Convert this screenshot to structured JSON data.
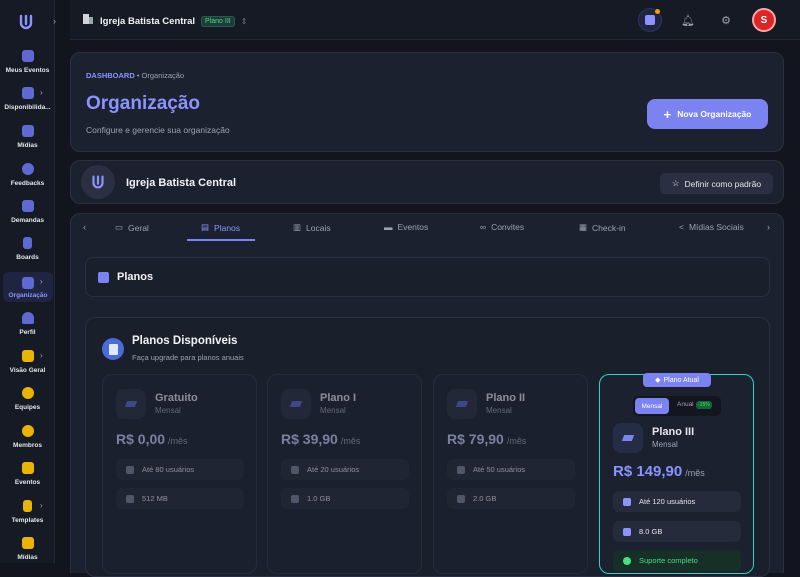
{
  "sidebar": {
    "items": [
      {
        "label": "Meus Eventos",
        "icon": "calendar-icon"
      },
      {
        "label": "Disponibilida...",
        "icon": "calendar-clock-icon",
        "has_arrow": true
      },
      {
        "label": "Mídias",
        "icon": "media-icon"
      },
      {
        "label": "Feedbacks",
        "icon": "chat-icon"
      },
      {
        "label": "Demandas",
        "icon": "inbox-icon"
      },
      {
        "label": "Boards",
        "icon": "board-icon"
      },
      {
        "label": "Organização",
        "icon": "building-icon",
        "has_arrow": true,
        "active": true
      },
      {
        "label": "Perfil",
        "icon": "user-icon"
      },
      {
        "label": "Visão Geral",
        "icon": "chart-icon",
        "has_arrow": true
      },
      {
        "label": "Equipes",
        "icon": "team-icon"
      },
      {
        "label": "Membros",
        "icon": "member-icon"
      },
      {
        "label": "Eventos",
        "icon": "event-icon"
      },
      {
        "label": "Templates",
        "icon": "template-icon",
        "has_arrow": true
      },
      {
        "label": "Mídias",
        "icon": "folder-icon"
      }
    ]
  },
  "topbar": {
    "org_name": "Igreja Batista Central",
    "plan_badge": "Plano III",
    "avatar_letter": "S"
  },
  "header": {
    "breadcrumb_root": "DASHBOARD",
    "breadcrumb_current": "• Organização",
    "title": "Organização",
    "subtitle": "Configure e gerencie sua organização",
    "new_button": "Nova Organização"
  },
  "org_card": {
    "name": "Igreja Batista Central",
    "default_button": "Definir como padrão"
  },
  "tabs": [
    "Geral",
    "Planos",
    "Locais",
    "Eventos",
    "Convites",
    "Check-in",
    "Mídias Sociais"
  ],
  "active_tab": "Planos",
  "section_title": "Planos",
  "plans_section": {
    "title": "Planos Disponíveis",
    "subtitle": "Faça upgrade para planos anuais"
  },
  "plans": [
    {
      "name": "Gratuito",
      "period": "Mensal",
      "price": "R$ 0,00",
      "per": "/mês",
      "users": "Até 80 usuários",
      "storage": "512 MB"
    },
    {
      "name": "Plano I",
      "period": "Mensal",
      "price": "R$ 39,90",
      "per": "/mês",
      "users": "Até 20 usuários",
      "storage": "1.0 GB"
    },
    {
      "name": "Plano II",
      "period": "Mensal",
      "price": "R$ 79,90",
      "per": "/mês",
      "users": "Até 50 usuários",
      "storage": "2.0 GB"
    },
    {
      "name": "Plano III",
      "period": "Mensal",
      "price": "R$ 149,90",
      "per": "/mês",
      "users": "Até 120 usuários",
      "storage": "8.0 GB",
      "support": "Suporte completo",
      "current_badge": "Plano Atual",
      "toggle_monthly": "Mensal",
      "toggle_annual": "Anual",
      "discount": "-15%"
    }
  ],
  "colors": {
    "accent": "#7b83f0",
    "bg": "#12151e",
    "card": "#1c2130",
    "current_border": "#2dd4bf"
  }
}
